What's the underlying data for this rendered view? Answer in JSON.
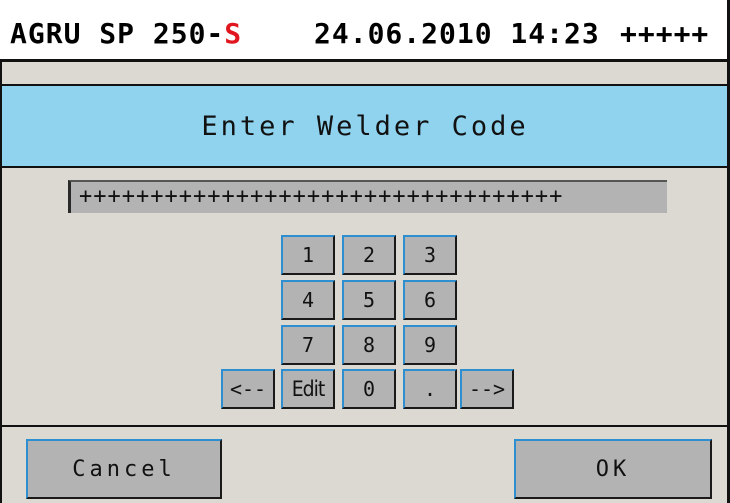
{
  "header": {
    "device_prefix": "AGRU SP 250-",
    "device_suffix": "S",
    "datetime": "24.06.2010 14:23",
    "status": "+++++"
  },
  "dialog": {
    "title": "Enter Welder Code",
    "code_value": "++++++++++++++++++++++++++++++++++"
  },
  "keypad": {
    "k1": "1",
    "k2": "2",
    "k3": "3",
    "k4": "4",
    "k5": "5",
    "k6": "6",
    "k7": "7",
    "k8": "8",
    "k9": "9",
    "back": "<--",
    "edit": "Edit",
    "k0": "0",
    "dot": ".",
    "fwd": "-->"
  },
  "footer": {
    "cancel_label": "Cancel",
    "ok_label": "OK"
  },
  "colors": {
    "title_band": "#8fd3ef",
    "panel_bg": "#dcd8d2",
    "key_bg": "#b3b3b3",
    "key_highlight": "#2e8fd0",
    "accent_red": "#e1171f"
  }
}
